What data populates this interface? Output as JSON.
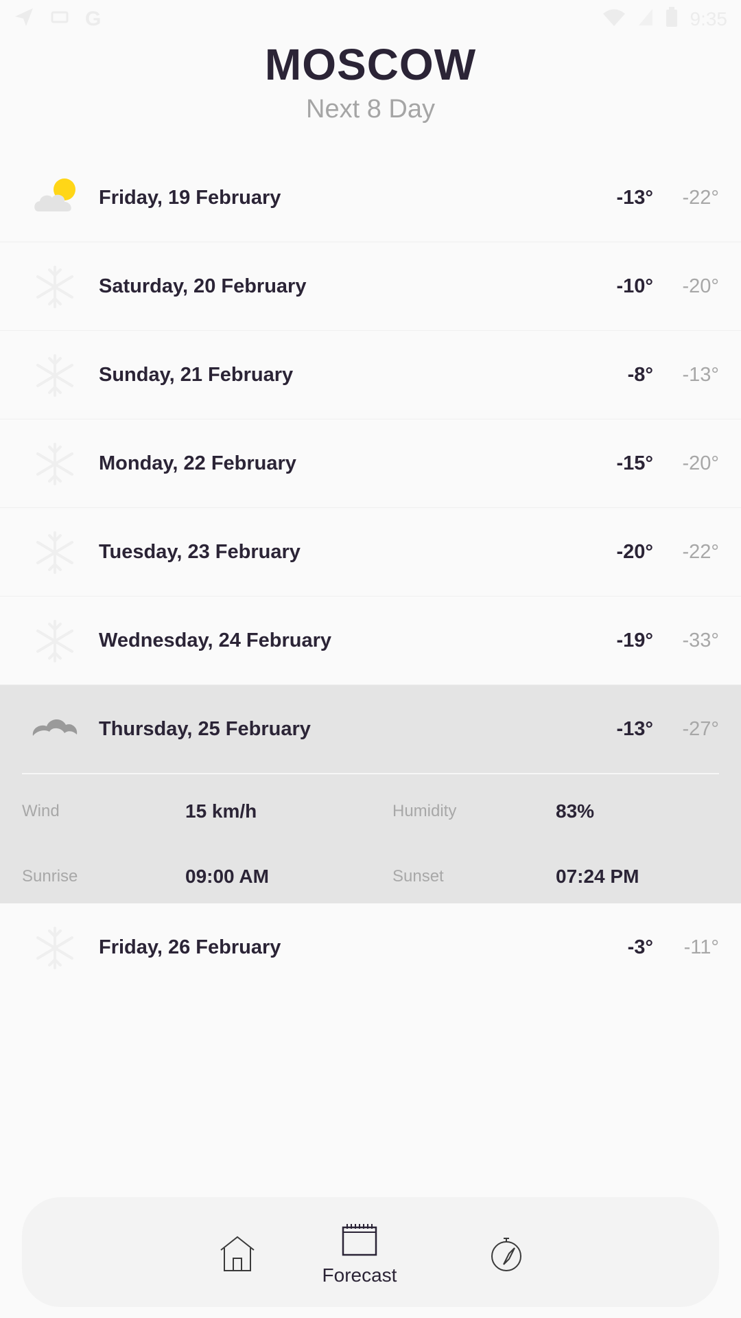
{
  "status_bar": {
    "time": "9:35",
    "carrier_letter": "G"
  },
  "header": {
    "city": "MOSCOW",
    "subtitle": "Next 8 Day"
  },
  "days": [
    {
      "label": "Friday, 19 February",
      "high": "-13°",
      "low": "-22°",
      "icon": "partly-cloudy-icon"
    },
    {
      "label": "Saturday, 20 February",
      "high": "-10°",
      "low": "-20°",
      "icon": "snow-icon"
    },
    {
      "label": "Sunday, 21 February",
      "high": "-8°",
      "low": "-13°",
      "icon": "snow-icon"
    },
    {
      "label": "Monday, 22 February",
      "high": "-15°",
      "low": "-20°",
      "icon": "snow-icon"
    },
    {
      "label": "Tuesday, 23 February",
      "high": "-20°",
      "low": "-22°",
      "icon": "snow-icon"
    },
    {
      "label": "Wednesday, 24 February",
      "high": "-19°",
      "low": "-33°",
      "icon": "snow-icon"
    },
    {
      "label": "Thursday, 25 February",
      "high": "-13°",
      "low": "-27°",
      "icon": "cloud-icon"
    },
    {
      "label": "Friday, 26 February",
      "high": "-3°",
      "low": "-11°",
      "icon": "snow-icon"
    }
  ],
  "details": {
    "wind_label": "Wind",
    "wind_value": "15 km/h",
    "humidity_label": "Humidity",
    "humidity_value": "83%",
    "sunrise_label": "Sunrise",
    "sunrise_value": "09:00 AM",
    "sunset_label": "Sunset",
    "sunset_value": "07:24 PM"
  },
  "nav": {
    "forecast_label": "Forecast",
    "items": [
      "home-icon",
      "calendar-icon",
      "compass-icon"
    ]
  },
  "colors": {
    "background": "#fafafa",
    "text_primary": "#2b2436",
    "text_secondary": "#a5a5a5",
    "expanded_bg": "#e4e4e4",
    "sun_yellow": "#ffd617",
    "nav_bg": "#f3f3f3"
  }
}
